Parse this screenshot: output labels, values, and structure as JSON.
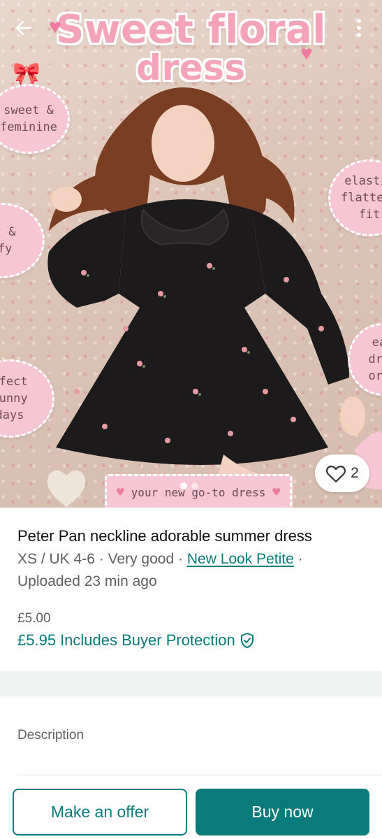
{
  "hero": {
    "title_line1": "Sweet floral",
    "title_line2": "dress",
    "bubbles": [
      {
        "line1": "sweet &",
        "line2": "feminine",
        "line3": ""
      },
      {
        "line1": "ft &",
        "line2": "mfy",
        "line3": ""
      },
      {
        "line1": "elastic",
        "line2": "flatteri",
        "line3": "fit"
      },
      {
        "line1": "rfect",
        "line2": "sunny",
        "line3": "days"
      },
      {
        "line1": "eas",
        "line2": "dres",
        "line3": "or c"
      }
    ],
    "banner_text": "your new go-to dress",
    "favourite_count": "2",
    "back_icon": "arrow-left-icon",
    "more_icon": "more-vertical-icon",
    "heart_icon": "heart-outline-icon"
  },
  "item": {
    "title": "Peter Pan neckline adorable summer dress",
    "size": "XS / UK 4-6",
    "condition": "Very good",
    "brand": "New Look Petite",
    "uploaded": "Uploaded 23 min ago",
    "sep": "·",
    "price": "£5.00",
    "total_price": "£5.95",
    "protection_label": "Includes Buyer Protection",
    "protection_icon": "shield-check-icon"
  },
  "description": {
    "label": "Description"
  },
  "actions": {
    "offer_label": "Make an offer",
    "buy_label": "Buy now"
  },
  "colors": {
    "accent": "#0a7b7b",
    "pink": "#f6c6d4"
  }
}
